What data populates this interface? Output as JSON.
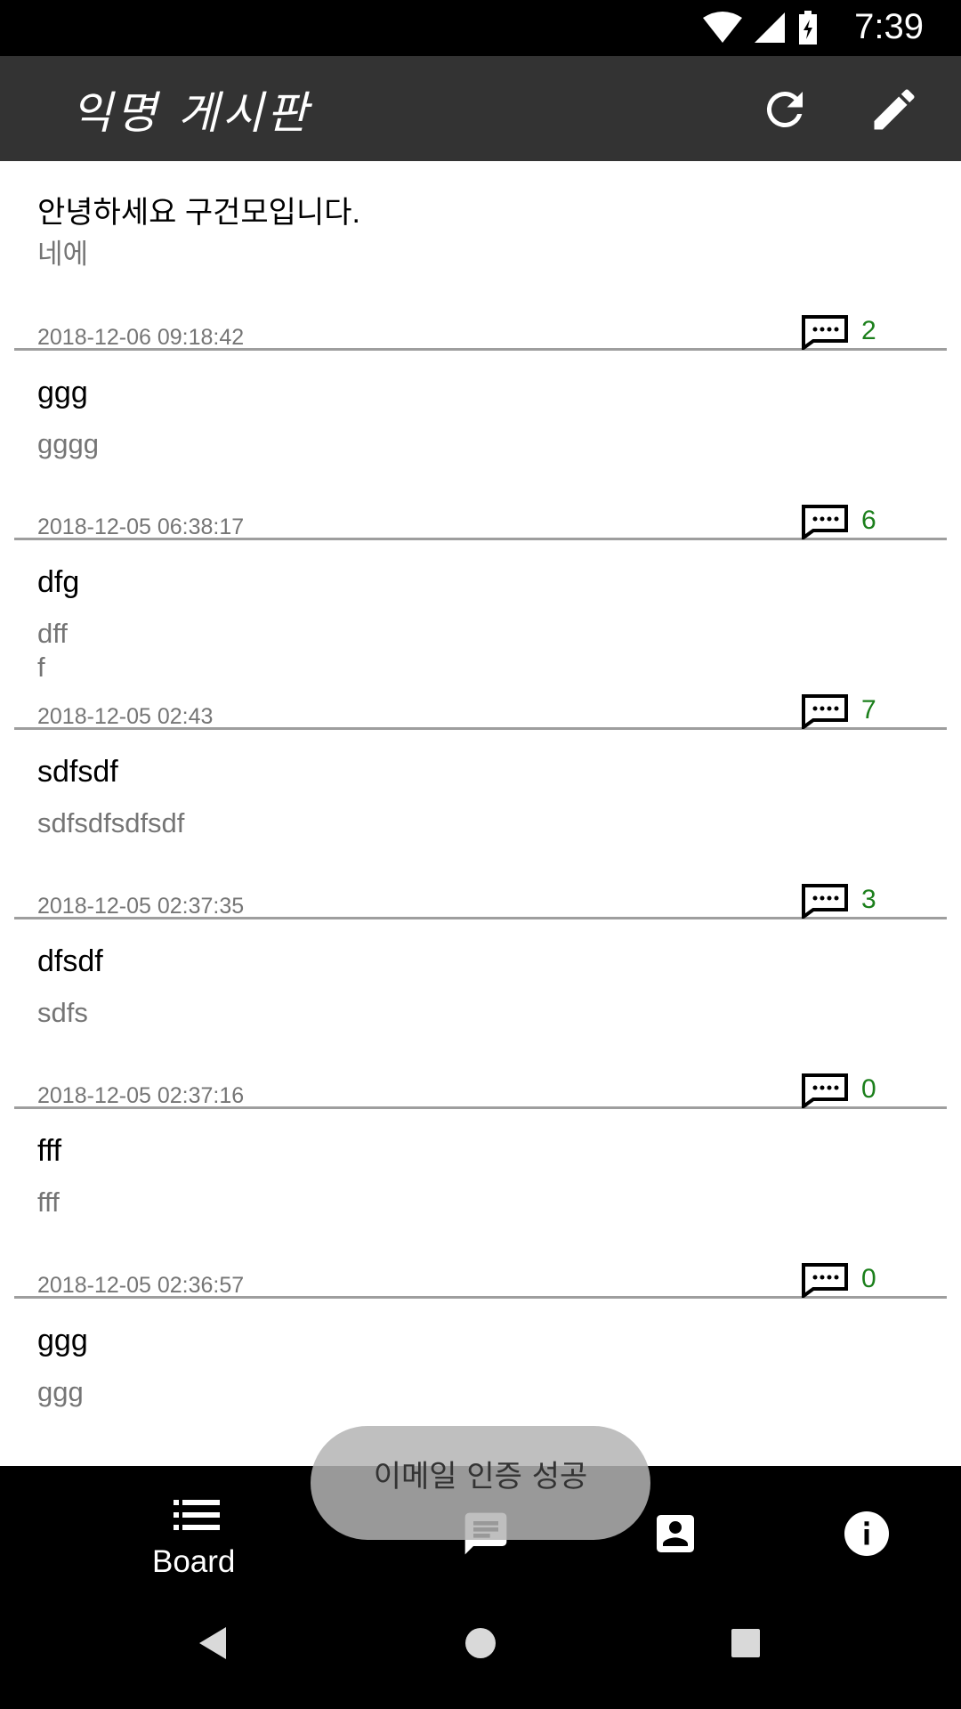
{
  "status": {
    "time": "7:39"
  },
  "app_bar": {
    "title": "익명 게시판",
    "refresh_icon": "refresh-icon",
    "edit_icon": "pencil-icon"
  },
  "posts": [
    {
      "title": "안녕하세요 구건모입니다.",
      "body": "네에",
      "date": "2018-12-06 09:18:42",
      "comments": "2"
    },
    {
      "title": "ggg",
      "body": "gggg",
      "date": "2018-12-05 06:38:17",
      "comments": "6"
    },
    {
      "title": "dfg",
      "body": "dff\nf",
      "date": "2018-12-05 02:43",
      "comments": "7"
    },
    {
      "title": "sdfsdf",
      "body": "sdfsdfsdfsdf",
      "date": "2018-12-05 02:37:35",
      "comments": "3"
    },
    {
      "title": "dfsdf",
      "body": "sdfs",
      "date": "2018-12-05 02:37:16",
      "comments": "0"
    },
    {
      "title": "fff",
      "body": "fff",
      "date": "2018-12-05 02:36:57",
      "comments": "0"
    },
    {
      "title": "ggg",
      "body": "ggg",
      "date": "",
      "comments": ""
    }
  ],
  "toast": {
    "text": "이메일 인증 성공"
  },
  "bottom_nav": {
    "board_label": "Board",
    "items": [
      "list-icon",
      "chat-icon",
      "contact-icon",
      "info-icon"
    ]
  },
  "colors": {
    "app_bar": "#333333",
    "comment_count": "#1b7f1b",
    "divider": "#9e9e9e"
  }
}
